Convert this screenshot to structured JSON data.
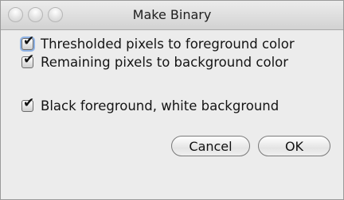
{
  "window": {
    "title": "Make Binary"
  },
  "options": [
    {
      "label": "Thresholded pixels to foreground color",
      "checked": true,
      "focused": true
    },
    {
      "label": "Remaining pixels to background color",
      "checked": true,
      "focused": false
    },
    {
      "label": "Black foreground, white background",
      "checked": true,
      "focused": false
    }
  ],
  "checkmark_glyph": "✔",
  "buttons": {
    "cancel_label": "Cancel",
    "ok_label": "OK"
  }
}
